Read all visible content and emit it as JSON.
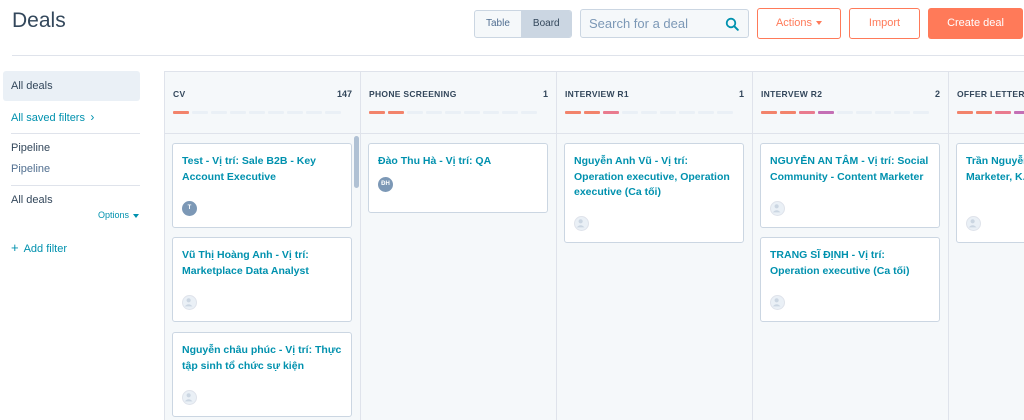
{
  "header": {
    "title": "Deals",
    "views": [
      "Table",
      "Board"
    ],
    "search_placeholder": "Search for a deal",
    "actions_label": "Actions",
    "import_label": "Import",
    "create_label": "Create deal"
  },
  "sidebar": {
    "active_item": "All deals",
    "saved_filters": "All saved filters",
    "pipeline_heading": "Pipeline",
    "pipeline_value": "Pipeline",
    "deals_heading": "All deals",
    "options_label": "Options",
    "add_filter": "Add filter"
  },
  "colors": {
    "accent": "#ff7a59",
    "link": "#0091ae",
    "text": "#33475b"
  },
  "columns": [
    {
      "title": "CV",
      "count": "147",
      "cards": [
        {
          "title": "Test - Vị trí: Sale B2B - Key Account Executive",
          "avatar": "T"
        },
        {
          "title": "Vũ Thị Hoàng Anh - Vị trí: Marketplace Data Analyst",
          "avatar": ""
        },
        {
          "title": "Nguyễn châu phúc - Vị trí: Thực tập sinh tổ chức sự kiện",
          "avatar": ""
        }
      ]
    },
    {
      "title": "PHONE SCREENING",
      "count": "1",
      "cards": [
        {
          "title": "Đào Thu Hà - Vị trí: QA",
          "avatar": "ĐH"
        }
      ]
    },
    {
      "title": "INTERVIEW R1",
      "count": "1",
      "cards": [
        {
          "title": "Nguyễn Anh Vũ - Vị trí: Operation executive, Operation executive (Ca tối)",
          "avatar": ""
        }
      ]
    },
    {
      "title": "INTERVEW R2",
      "count": "2",
      "cards": [
        {
          "title": "NGUYỄN AN TÂM - Vị trí: Social Community - Content Marketer",
          "avatar": ""
        },
        {
          "title": "TRANG SĨ ĐỊNH - Vị trí: Operation executive (Ca tối)",
          "avatar": ""
        }
      ]
    },
    {
      "title": "OFFER LETTER",
      "count": "",
      "cards": [
        {
          "title": "Trần Nguyễn... Social Comm... Marketer, K...",
          "avatar": ""
        }
      ]
    }
  ]
}
